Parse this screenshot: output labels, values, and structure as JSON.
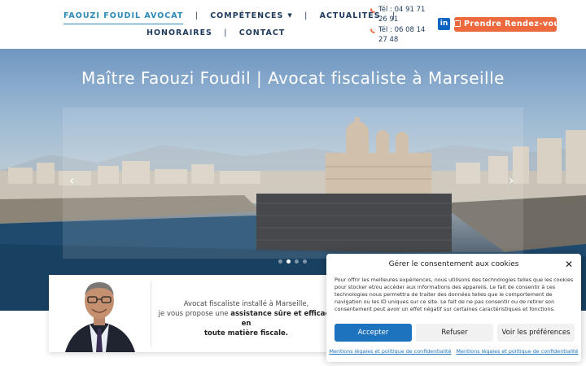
{
  "nav": {
    "items": [
      {
        "label": "FAOUZI FOUDIL AVOCAT",
        "active": true
      },
      {
        "label": "COMPÉTENCES",
        "has_dropdown": true
      },
      {
        "label": "ACTUALITÉS"
      },
      {
        "label": "HONORAIRES"
      },
      {
        "label": "CONTACT"
      }
    ],
    "separator": "|"
  },
  "contact": {
    "phone1": "Tél : 04 91 71 26 91",
    "phone2": "Tél : 06 08 14 27 48",
    "linkedin_icon": "linkedin-icon",
    "linkedin_text": "in",
    "cta_label": "Prendre Rendez-vous",
    "cta_icon": "calendar-icon"
  },
  "hero": {
    "title": "Maître Faouzi Foudil | Avocat fiscaliste à Marseille",
    "slides_count": 4,
    "active_slide": 1,
    "prev_glyph": "‹",
    "next_glyph": "›"
  },
  "intro": {
    "line1": "Avocat fiscaliste installé à Marseille,",
    "line2_plain": "je vous propose une ",
    "line2_bold": "assistance sûre et efficace en",
    "line3_bold": "toute matière fiscale."
  },
  "consent": {
    "title": "Gérer le consentement aux cookies",
    "close_glyph": "✕",
    "body": "Pour offrir les meilleures expériences, nous utilisons des technologies telles que les cookies pour stocker et/ou accéder aux informations des appareils. Le fait de consentir à ces technologies nous permettra de traiter des données telles que le comportement de navigation ou les ID uniques sur ce site. Le fait de ne pas consentir ou de retirer son consentement peut avoir un effet négatif sur certaines caractéristiques et fonctions.",
    "accept": "Accepter",
    "refuse": "Refuser",
    "preferences": "Voir les préférences",
    "link1": "Mentions légales et politique de confidentialité",
    "link2": "Mentions légales et politique de confidentialité"
  },
  "colors": {
    "navy": "#1d3a5c",
    "accent_blue": "#2a8ab8",
    "cta_orange": "#ec6a3e",
    "consent_blue": "#1e73be"
  }
}
